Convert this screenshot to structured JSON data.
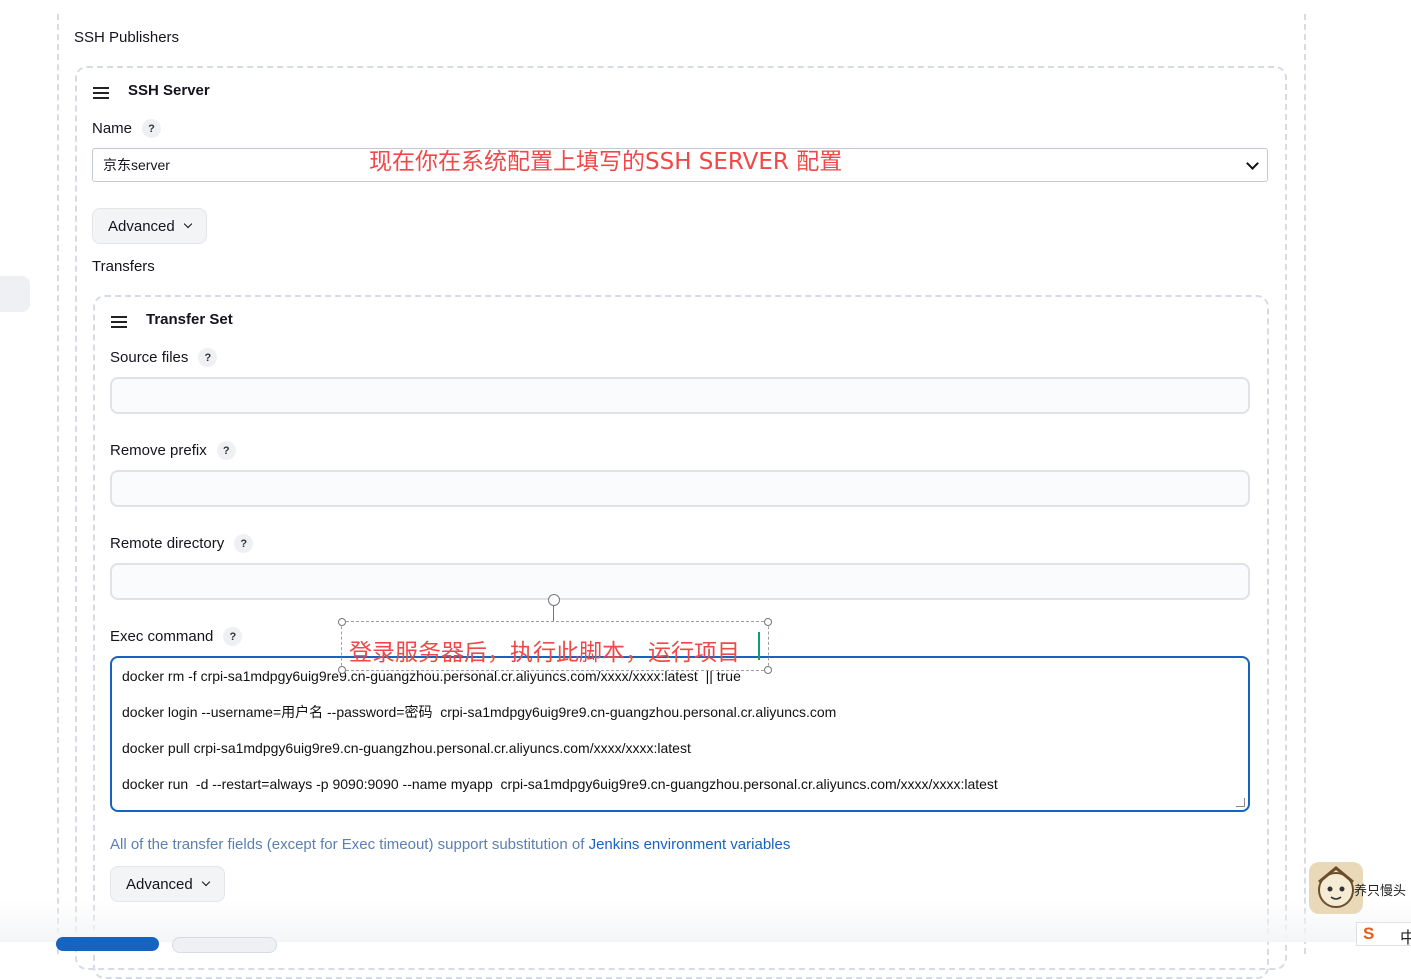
{
  "ssh_publishers": {
    "label": "SSH Publishers"
  },
  "ssh_server": {
    "title": "SSH Server",
    "name_label": "Name",
    "help": "?",
    "name_value": "京东server",
    "advanced_label": "Advanced",
    "transfers_label": "Transfers"
  },
  "transfer_set": {
    "title": "Transfer Set",
    "source_files_label": "Source files",
    "remove_prefix_label": "Remove prefix",
    "remote_directory_label": "Remote directory",
    "exec_command_label": "Exec command",
    "help": "?",
    "exec_lines": [
      "docker rm -f crpi-sa1mdpgy6uig9re9.cn-guangzhou.personal.cr.aliyuncs.com/xxxx/xxxx:latest  || true",
      "docker login --username=用户名 --password=密码  crpi-sa1mdpgy6uig9re9.cn-guangzhou.personal.cr.aliyuncs.com",
      "docker pull crpi-sa1mdpgy6uig9re9.cn-guangzhou.personal.cr.aliyuncs.com/xxxx/xxxx:latest",
      "docker run  -d --restart=always -p 9090:9090 --name myapp  crpi-sa1mdpgy6uig9re9.cn-guangzhou.personal.cr.aliyuncs.com/xxxx/xxxx:latest"
    ],
    "hint_prefix": "All of the transfer fields (except for Exec timeout) support substitution of ",
    "hint_link": "Jenkins environment variables",
    "advanced_label": "Advanced"
  },
  "annotations": {
    "server_note": "现在你在系统配置上填写的SSH SERVER 配置",
    "exec_note": "登录服务器后，执行此脚本，运行项目"
  },
  "overlay": {
    "mascot_text": "养只慢头",
    "ime_logo": "S",
    "ime_mode": "中"
  },
  "colors": {
    "accent": "#1565c0",
    "annotation": "#f04848",
    "hint": "#5b7fb0"
  }
}
